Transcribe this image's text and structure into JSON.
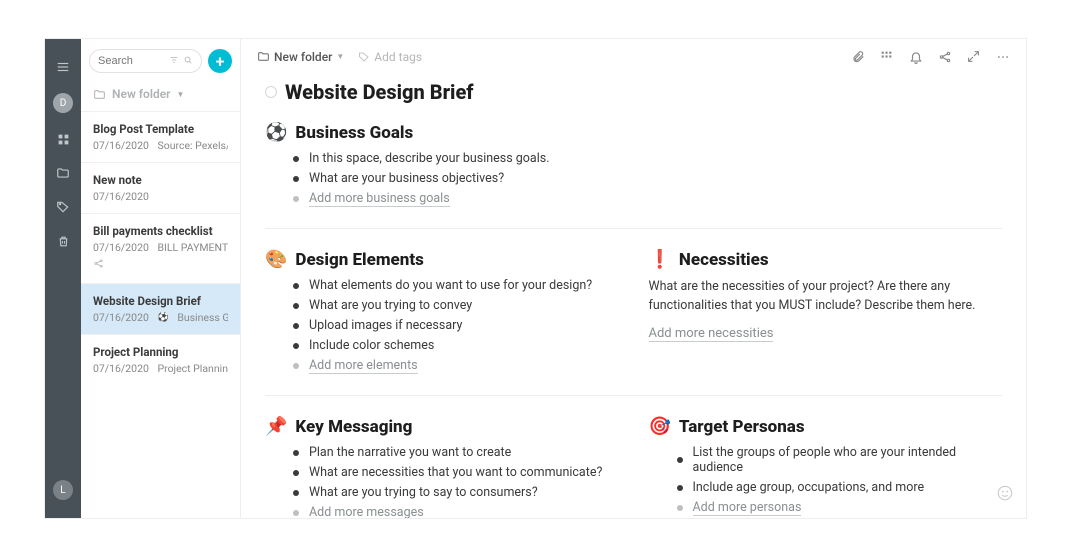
{
  "rail": {
    "avatar_letter": "D",
    "bottom_avatar_letter": "L"
  },
  "sidebar": {
    "search_placeholder": "Search",
    "folder_label": "New folder",
    "notes": [
      {
        "title": "Blog Post Template",
        "date": "07/16/2020",
        "excerpt": "Source: Pexels/..."
      },
      {
        "title": "New note",
        "date": "07/16/2020",
        "excerpt": ""
      },
      {
        "title": "Bill payments checklist",
        "date": "07/16/2020",
        "excerpt": "BILL PAYMENTS..."
      },
      {
        "title": "Website Design Brief",
        "date": "07/16/2020",
        "excerpt": "Business Go..."
      },
      {
        "title": "Project Planning",
        "date": "07/16/2020",
        "excerpt": "Project Plannin..."
      }
    ]
  },
  "topbar": {
    "breadcrumb": "New folder",
    "addtags": "Add tags"
  },
  "page": {
    "title": "Website Design Brief",
    "sections": {
      "business_goals": {
        "emoji": "⚽",
        "title": "Business Goals",
        "items": [
          "In this space, describe your business goals.",
          "What are your business objectives?"
        ],
        "add": "Add more business goals"
      },
      "design_elements": {
        "emoji": "🎨",
        "title": "Design Elements",
        "items": [
          "What elements do you want to use for your design?",
          "What are you trying to convey",
          "Upload images if necessary",
          "Include color schemes"
        ],
        "add": "Add more elements"
      },
      "necessities": {
        "emoji": "❗",
        "title": "Necessities",
        "para": "What are the necessities of your project? Are there any functionalities that you MUST include? Describe them here.",
        "add": "Add more necessities"
      },
      "key_messaging": {
        "emoji": "📌",
        "title": "Key Messaging",
        "items": [
          "Plan the narrative you want to create",
          "What are necessities that you want to communicate?",
          "What are you trying to say to consumers?"
        ],
        "add": "Add more messages"
      },
      "target_personas": {
        "emoji": "🎯",
        "title": "Target Personas",
        "items": [
          "List the groups of people who are your intended audience",
          "Include age group, occupations, and more"
        ],
        "add": "Add more personas"
      }
    }
  }
}
